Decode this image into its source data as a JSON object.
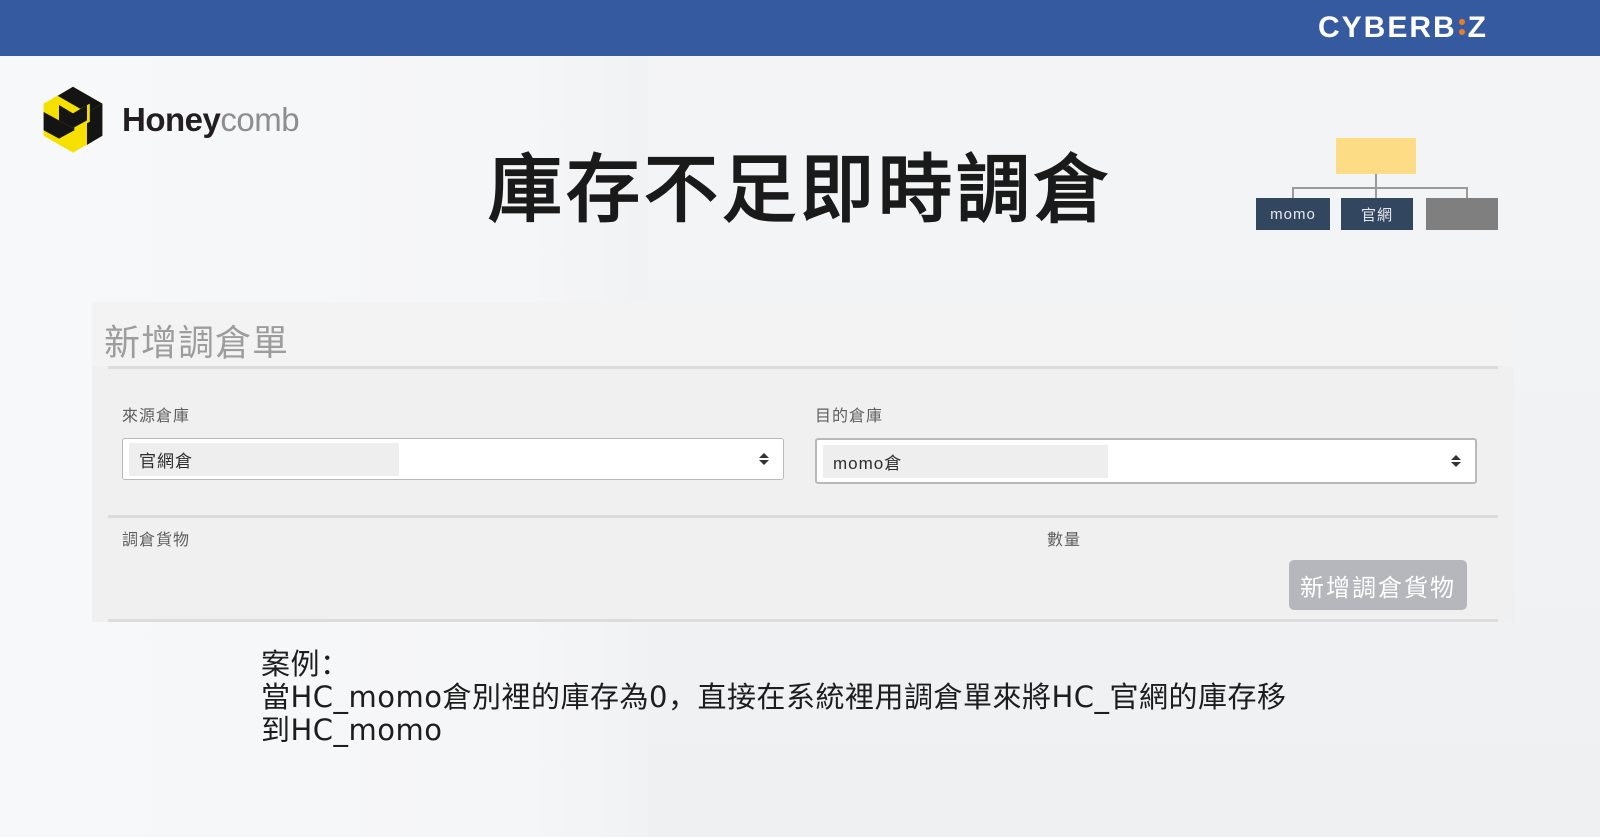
{
  "topbar": {
    "brand_text_1": "CYBERB",
    "brand_icon": "cyberbiz-i-dots",
    "brand_text_2": "Z",
    "color": "#355aa0",
    "dot_color": "#f07c22"
  },
  "logo": {
    "icon": "honeycomb-cube-icon",
    "word_bold": "Honey",
    "word_light": "comb",
    "cube_yellow": "#f5e000",
    "cube_black": "#141414"
  },
  "headline": {
    "text": "庫存不足即時調倉"
  },
  "orgchart": {
    "top_box_label": "",
    "top_box_color": "#fcdd86",
    "boxes": [
      {
        "label": "momo",
        "color": "#33465f"
      },
      {
        "label": "官網",
        "color": "#33465f"
      },
      {
        "label": "",
        "color": "#7f7f7f"
      }
    ]
  },
  "panel": {
    "title": "新增調倉單",
    "fields": {
      "source": {
        "label": "來源倉庫",
        "value": "官網倉",
        "arrow_icon": "select-updown-arrow-icon"
      },
      "destination": {
        "label": "目的倉庫",
        "value": "momo倉",
        "arrow_icon": "select-updown-arrow-icon"
      }
    },
    "goods_label": "調倉貨物",
    "quantity_label": "數量",
    "add_goods_button": "新增調倉貨物",
    "button_color": "#b5b7bd"
  },
  "caption": {
    "line1": "案例：",
    "line2": "當HC_momo倉別裡的庫存為0，直接在系統裡用調倉單來將HC_官網的庫存移",
    "line3": "到HC_momo"
  }
}
